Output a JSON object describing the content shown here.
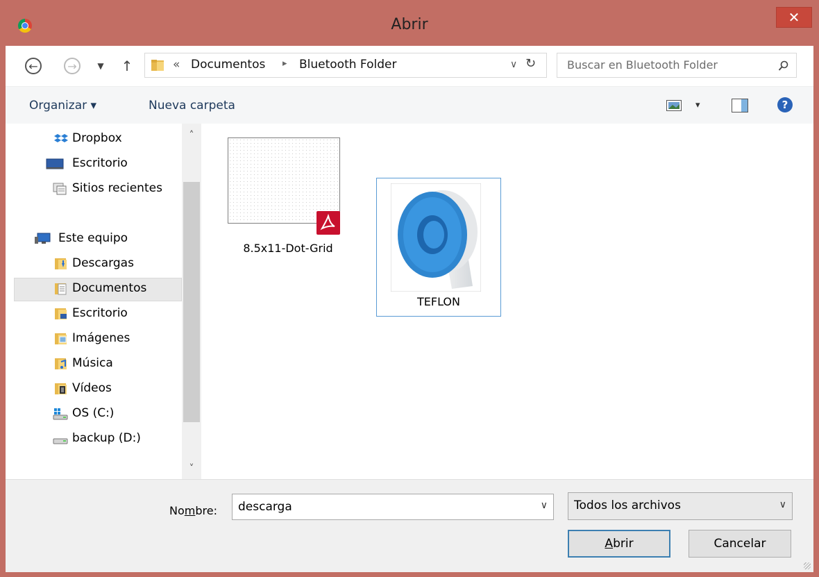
{
  "window": {
    "title": "Abrir",
    "close": "✕"
  },
  "address": {
    "overflow": "«",
    "crumbs": [
      "Documentos",
      "Bluetooth Folder"
    ],
    "sep": "▸",
    "dropdown": "∨",
    "refresh": "↻"
  },
  "search": {
    "placeholder": "Buscar en Bluetooth Folder"
  },
  "toolbar": {
    "organize": "Organizar ▾",
    "new_folder": "Nueva carpeta",
    "view_drop": "▾",
    "help": "?"
  },
  "nav": {
    "items": [
      {
        "label": "Dropbox",
        "icon": "dropbox-icon"
      },
      {
        "label": "Escritorio",
        "icon": "desktop-icon"
      },
      {
        "label": "Sitios recientes",
        "icon": "recent-places-icon"
      },
      {
        "label": "Este equipo",
        "icon": "computer-icon"
      },
      {
        "label": "Descargas",
        "icon": "downloads-folder-icon"
      },
      {
        "label": "Documentos",
        "icon": "documents-folder-icon"
      },
      {
        "label": "Escritorio",
        "icon": "desktop-folder-icon"
      },
      {
        "label": "Imágenes",
        "icon": "pictures-folder-icon"
      },
      {
        "label": "Música",
        "icon": "music-folder-icon"
      },
      {
        "label": "Vídeos",
        "icon": "videos-folder-icon"
      },
      {
        "label": "OS (C:)",
        "icon": "drive-c-icon"
      },
      {
        "label": "backup (D:)",
        "icon": "drive-d-icon"
      }
    ],
    "selected": "Documentos",
    "scroll_up": "˄",
    "scroll_down": "˅"
  },
  "files": [
    {
      "name": "8.5x11-Dot-Grid",
      "type": "pdf"
    },
    {
      "name": "TEFLON",
      "type": "image",
      "selected": true
    }
  ],
  "bottom": {
    "name_label_pre": "No",
    "name_label_u": "m",
    "name_label_post": "bre:",
    "name_value": "descarga",
    "type_value": "Todos los archivos",
    "open_u": "A",
    "open_rest": "brir",
    "cancel": "Cancelar",
    "drop": "∨"
  },
  "colors": {
    "frame": "#c26e64",
    "close": "#c7483b",
    "selection": "#5a9bd5",
    "toolbar_text": "#1e395b"
  }
}
